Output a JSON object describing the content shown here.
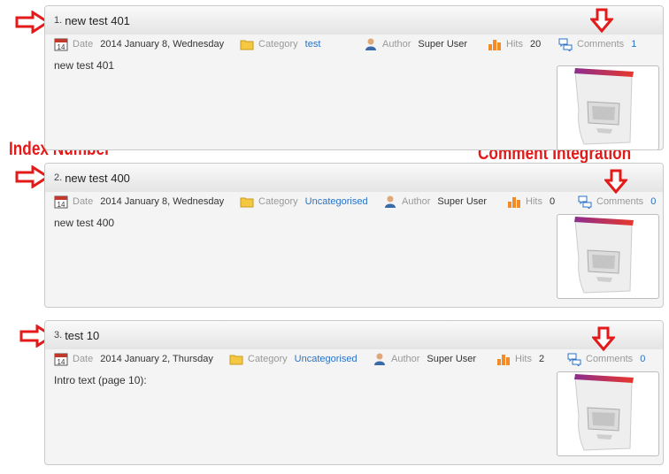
{
  "articles": [
    {
      "index": "1.",
      "title": "new test 401",
      "date_label": "Date",
      "date": "2014 January 8, Wednesday",
      "category_label": "Category",
      "category": "test",
      "author_label": "Author",
      "author": "Super User",
      "hits_label": "Hits",
      "hits": "20",
      "comments_label": "Comments",
      "comments": "1",
      "intro": "new test 401"
    },
    {
      "index": "2.",
      "title": "new test 400",
      "date_label": "Date",
      "date": "2014 January 8, Wednesday",
      "category_label": "Category",
      "category": "Uncategorised",
      "author_label": "Author",
      "author": "Super User",
      "hits_label": "Hits",
      "hits": "0",
      "comments_label": "Comments",
      "comments": "0",
      "intro": "new test 400"
    },
    {
      "index": "3.",
      "title": "test 10",
      "date_label": "Date",
      "date": "2014 January 2, Thursday",
      "category_label": "Category",
      "category": "Uncategorised",
      "author_label": "Author",
      "author": "Super User",
      "hits_label": "Hits",
      "hits": "2",
      "comments_label": "Comments",
      "comments": "0",
      "intro": "Intro text (page 10):"
    }
  ],
  "calendar_day": "14",
  "annotations": {
    "index_number": "Index Number",
    "comment_integration": "Comment Integration",
    "color": "#e31a1a"
  },
  "icons": [
    "calendar-icon",
    "folder-icon",
    "author-icon",
    "hits-bar-icon",
    "comments-bubble-icon",
    "right-arrow-icon",
    "down-arrow-icon"
  ],
  "colors": {
    "link": "#2a72c3",
    "thumb_bar": "#8b2d8e",
    "thumb_bar_end": "#e8372b"
  }
}
